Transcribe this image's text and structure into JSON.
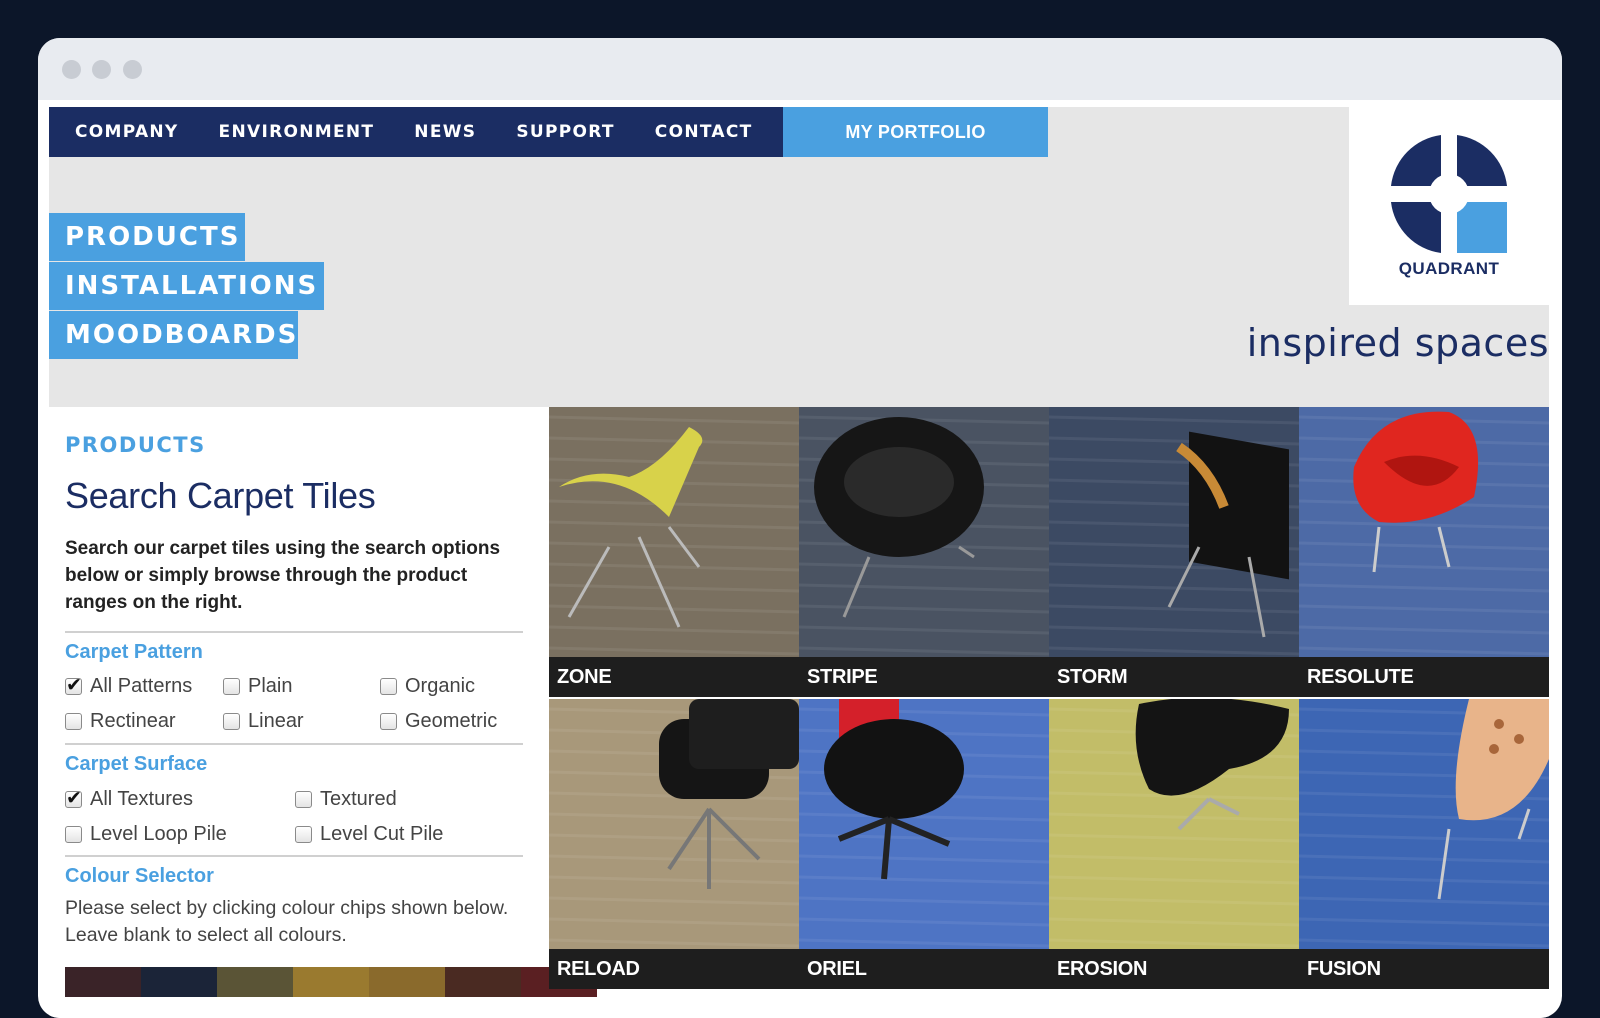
{
  "nav": {
    "links": [
      "COMPANY",
      "ENVIRONMENT",
      "NEWS",
      "SUPPORT",
      "CONTACT"
    ],
    "portfolio": "MY PORTFOLIO"
  },
  "brand": {
    "logo_text": "QUADRANT",
    "tagline": "inspired spaces"
  },
  "main_nav": [
    "PRODUCTS",
    "INSTALLATIONS",
    "MOODBOARDS"
  ],
  "panel": {
    "eyebrow": "PRODUCTS",
    "title": "Search Carpet Tiles",
    "intro": "Search our carpet tiles using the search options below or simply browse through the product ranges on the right.",
    "pattern": {
      "heading": "Carpet Pattern",
      "options": [
        {
          "label": "All Patterns",
          "checked": true
        },
        {
          "label": "Plain",
          "checked": false
        },
        {
          "label": "Organic",
          "checked": false
        },
        {
          "label": "Rectinear",
          "checked": false
        },
        {
          "label": "Linear",
          "checked": false
        },
        {
          "label": "Geometric",
          "checked": false
        }
      ]
    },
    "surface": {
      "heading": "Carpet Surface",
      "options": [
        {
          "label": "All Textures",
          "checked": true
        },
        {
          "label": "Textured",
          "checked": false
        },
        {
          "label": "Level Loop Pile",
          "checked": false
        },
        {
          "label": "Level Cut Pile",
          "checked": false
        }
      ]
    },
    "colour": {
      "heading": "Colour Selector",
      "help": "Please select by clicking colour chips shown below. Leave blank to select all colours.",
      "chips": [
        "#3a2328",
        "#1b2438",
        "#5a5436",
        "#9a7a2f",
        "#8a6a2c",
        "#4a2a22",
        "#5a1f22"
      ]
    }
  },
  "products": [
    {
      "name": "ZONE",
      "carpet": "#7a7060",
      "chair": "#d8d24a"
    },
    {
      "name": "STRIPE",
      "carpet": "#4a5362",
      "chair": "#161616"
    },
    {
      "name": "STORM",
      "carpet": "#3c4a63",
      "chair": "#121212"
    },
    {
      "name": "RESOLUTE",
      "carpet": "#4d6aa6",
      "chair": "#e0261f"
    },
    {
      "name": "RELOAD",
      "carpet": "#a8987a",
      "chair": "#151515"
    },
    {
      "name": "ORIEL",
      "carpet": "#4e74c4",
      "chair": "#121212"
    },
    {
      "name": "EROSION",
      "carpet": "#c2bd68",
      "chair": "#141414"
    },
    {
      "name": "FUSION",
      "carpet": "#3d66b4",
      "chair": "#e8b48a"
    }
  ]
}
